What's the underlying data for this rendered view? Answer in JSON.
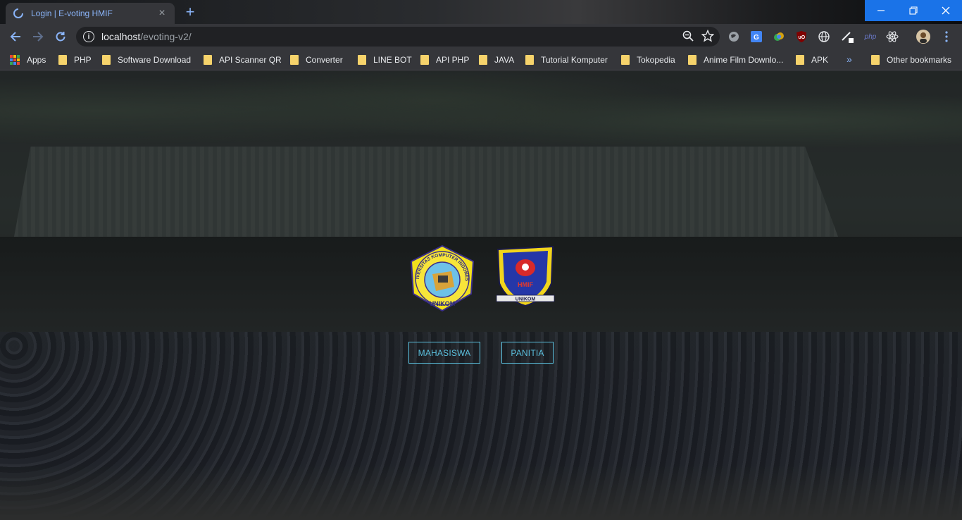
{
  "browser": {
    "tab": {
      "title": "Login | E-voting HMIF",
      "close_glyph": "×",
      "favicon": "loading-spinner-icon"
    },
    "new_tab_glyph": "+",
    "window_controls": {
      "minimize": "—",
      "maximize": "❐",
      "close": "✕"
    },
    "address": {
      "host": "localhost",
      "path": "/evoting-v2/"
    },
    "bookmarks": [
      {
        "label": "Apps",
        "icon": "apps-grid-icon"
      },
      {
        "label": "PHP",
        "icon": "folder-icon"
      },
      {
        "label": "Software Download",
        "icon": "folder-icon"
      },
      {
        "label": "API Scanner QR",
        "icon": "folder-icon"
      },
      {
        "label": "Converter",
        "icon": "folder-icon"
      },
      {
        "label": "LINE BOT",
        "icon": "folder-icon"
      },
      {
        "label": "API PHP",
        "icon": "folder-icon"
      },
      {
        "label": "JAVA",
        "icon": "folder-icon"
      },
      {
        "label": "Tutorial Komputer",
        "icon": "folder-icon"
      },
      {
        "label": "Tokopedia",
        "icon": "folder-icon"
      },
      {
        "label": "Anime Film Downlo...",
        "icon": "folder-icon"
      },
      {
        "label": "APK",
        "icon": "folder-icon"
      }
    ],
    "bookmarks_overflow": "»",
    "other_bookmarks": "Other bookmarks",
    "extension_php_label": "php"
  },
  "page": {
    "logos": {
      "university": {
        "ring_text": "UNIVERSITAS KOMPUTER INDONESIA",
        "bottom_text": "UNIKOM"
      },
      "hmif": {
        "center_text": "HMIF",
        "bottom_text": "UNIKOM"
      }
    },
    "buttons": {
      "mahasiswa": "MAHASISWA",
      "panitia": "PANITIA"
    }
  },
  "colors": {
    "accent_link": "#8ab4f8",
    "button_outline": "#5bc0de",
    "window_control_bg": "#1a73e8",
    "toolbar_bg": "#35363a"
  }
}
